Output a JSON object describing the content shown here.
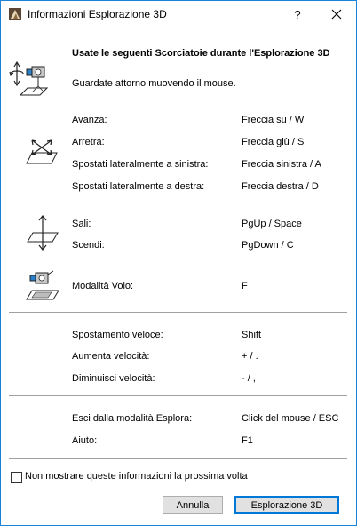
{
  "window": {
    "title": "Informazioni Esplorazione 3D",
    "help_label": "?"
  },
  "intro": {
    "heading": "Usate le seguenti Scorciatoie durante l'Esplorazione 3D",
    "look_text": "Guardate attorno muovendo il mouse."
  },
  "move_group": [
    {
      "action": "Avanza:",
      "key": "Freccia su / W"
    },
    {
      "action": "Arretra:",
      "key": "Freccia giù / S"
    },
    {
      "action": "Spostati lateralmente a sinistra:",
      "key": "Freccia sinistra / A"
    },
    {
      "action": "Spostati lateralmente a destra:",
      "key": "Freccia destra / D"
    }
  ],
  "vertical_group": [
    {
      "action": "Sali:",
      "key": "PgUp / Space"
    },
    {
      "action": "Scendi:",
      "key": "PgDown / C"
    }
  ],
  "fly_group": [
    {
      "action": "Modalità Volo:",
      "key": "F"
    }
  ],
  "speed_group": [
    {
      "action": "Spostamento veloce:",
      "key": "Shift"
    },
    {
      "action": "Aumenta velocità:",
      "key": "+ / ."
    },
    {
      "action": "Diminuisci velocità:",
      "key": "- / ,"
    }
  ],
  "exit_group": [
    {
      "action": "Esci dalla modalità Esplora:",
      "key": "Click del mouse / ESC"
    },
    {
      "action": "Aiuto:",
      "key": "F1"
    }
  ],
  "footer": {
    "dont_show_label": "Non mostrare queste informazioni la prossima volta",
    "dont_show_checked": false,
    "cancel_label": "Annulla",
    "ok_label": "Esplorazione 3D"
  },
  "icons": {
    "app": "archicad-app-icon",
    "look": "camera-look-icon",
    "move": "move-plane-arrows-icon",
    "vertical": "vertical-move-icon",
    "fly": "fly-mode-camera-icon"
  }
}
